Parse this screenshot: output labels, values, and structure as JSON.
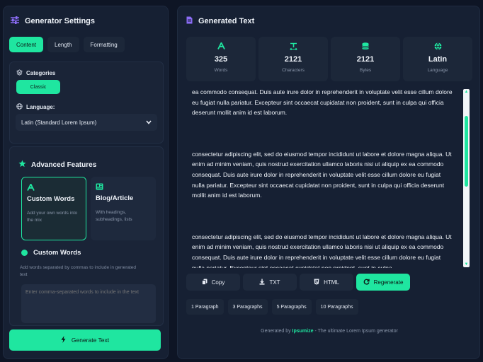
{
  "settings": {
    "title": "Generator Settings",
    "tabs": [
      "Content",
      "Length",
      "Formatting"
    ],
    "categories_label": "Categories",
    "category_selected": "Classic",
    "language_label": "Language:",
    "language_value": "Latin (Standard Lorem Ipsum)",
    "advanced_title": "Advanced Features",
    "features": [
      {
        "title": "Custom Words",
        "desc": "Add your own words into the mix"
      },
      {
        "title": "Blog/Article",
        "desc": "With headings, subheadings, lists"
      }
    ],
    "custom_words_title": "Custom Words",
    "custom_words_desc": "Add words separated by commas to include in generated text",
    "custom_words_placeholder": "Enter comma-separated words to include in the text",
    "generate_label": "Generate Text"
  },
  "output": {
    "title": "Generated Text",
    "stats": [
      {
        "value": "325",
        "label": "Words",
        "icon": "letter-a-icon"
      },
      {
        "value": "2121",
        "label": "Characters",
        "icon": "text-icon"
      },
      {
        "value": "2121",
        "label": "Bytes",
        "icon": "database-icon"
      },
      {
        "value": "Latin",
        "label": "Language",
        "icon": "globe-icon"
      }
    ],
    "paragraphs": [
      "ea commodo consequat. Duis aute irure dolor in reprehenderit in voluptate velit esse cillum dolore eu fugiat nulla pariatur. Excepteur sint occaecat cupidatat non proident, sunt in culpa qui officia deserunt mollit anim id est laborum.",
      "consectetur adipiscing elit, sed do eiusmod tempor incididunt ut labore et dolore magna aliqua. Ut enim ad minim veniam, quis nostrud exercitation ullamco laboris nisi ut aliquip ex ea commodo consequat. Duis aute irure dolor in reprehenderit in voluptate velit esse cillum dolore eu fugiat nulla pariatur. Excepteur sint occaecat cupidatat non proident, sunt in culpa qui officia deserunt mollit anim id est laborum.",
      "consectetur adipiscing elit, sed do eiusmod tempor incididunt ut labore et dolore magna aliqua. Ut enim ad minim veniam, quis nostrud exercitation ullamco laboris nisi ut aliquip ex ea commodo consequat. Duis aute irure dolor in reprehenderit in voluptate velit esse cillum dolore eu fugiat nulla pariatur. Excepteur sint occaecat cupidatat non proident, sunt in culpa"
    ],
    "actions": [
      "Copy",
      "TXT",
      "HTML",
      "Regenerate"
    ],
    "presets": [
      "1 Paragraph",
      "3 Paragraphs",
      "5 Paragraphs",
      "10 Paragraphs"
    ],
    "footer_prefix": "Generated by",
    "footer_brand": "Ipsumize",
    "footer_suffix": "- The ultimate Lorem Ipsum generator"
  },
  "colors": {
    "accent": "#1fe6a0",
    "background": "#0e1525",
    "panel": "#162033"
  }
}
